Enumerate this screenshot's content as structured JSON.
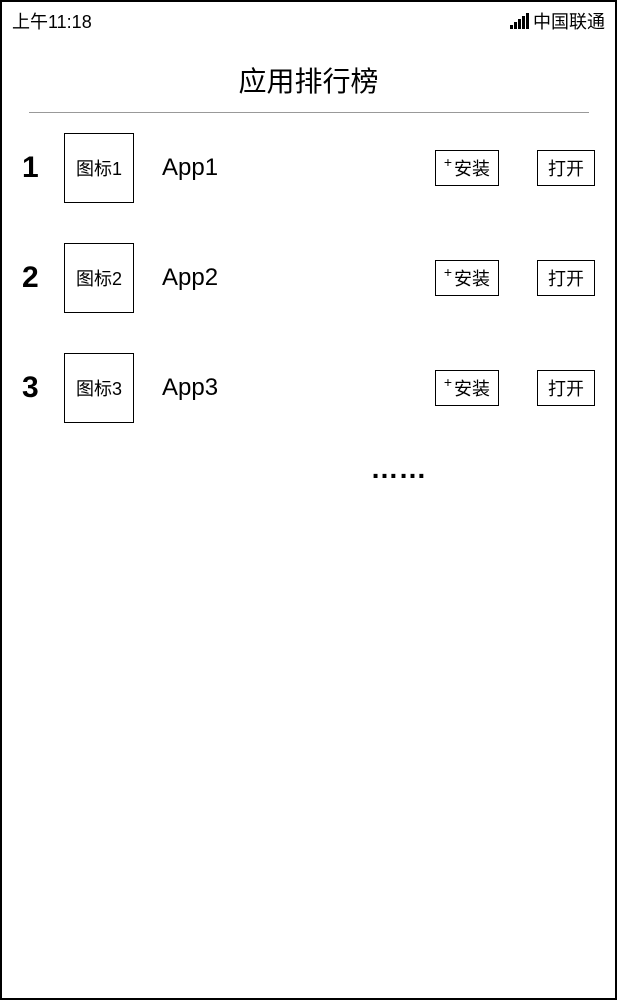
{
  "status_bar": {
    "time": "上午11:18",
    "carrier": "中国联通"
  },
  "page_title": "应用排行榜",
  "apps": [
    {
      "rank": "1",
      "icon_label": "图标1",
      "name": "App1",
      "install_label": "安装",
      "open_label": "打开"
    },
    {
      "rank": "2",
      "icon_label": "图标2",
      "name": "App2",
      "install_label": "安装",
      "open_label": "打开"
    },
    {
      "rank": "3",
      "icon_label": "图标3",
      "name": "App3",
      "install_label": "安装",
      "open_label": "打开"
    }
  ],
  "ellipsis": "……",
  "plus_sign": "+"
}
